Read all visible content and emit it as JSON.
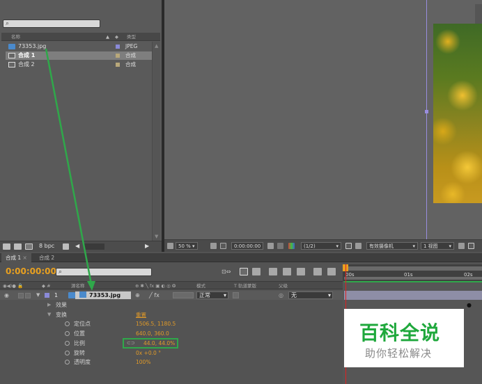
{
  "project": {
    "col_name": "名称",
    "col_type": "类型",
    "items": [
      {
        "name": "73353.jpg",
        "type": "JPEG",
        "swatch": "#8a8ad8",
        "icon": "image-file-icon"
      },
      {
        "name": "合成 1",
        "type": "合成",
        "swatch": "#b8a87a",
        "icon": "composition-icon",
        "selected": true
      },
      {
        "name": "合成 2",
        "type": "合成",
        "swatch": "#b8a87a",
        "icon": "composition-icon"
      }
    ],
    "footer_bpc": "8 bpc"
  },
  "viewer": {
    "zoom": "50 %",
    "timecode": "0:00:00:00",
    "resolution": "(1/2)",
    "camera": "有效摄像机",
    "views": "1 视图"
  },
  "timeline": {
    "tabs": [
      "合成 1",
      "合成 2"
    ],
    "timecode": "0:00:00:00",
    "ruler": [
      "00s",
      "01s",
      "02s"
    ],
    "columns": {
      "layer_name": "源名称",
      "mode": "模式",
      "trkmat": "T  轨道蒙版",
      "parent": "父级"
    },
    "layer": {
      "index": "1",
      "name": "73353.jpg",
      "mode": "正常",
      "parent": "无"
    },
    "groups": {
      "effects": "效果",
      "transform": "变换",
      "reset": "重置"
    },
    "properties": [
      {
        "name": "定位点",
        "value": "1506.5, 1180.5"
      },
      {
        "name": "位置",
        "value": "640.0, 360.0"
      },
      {
        "name": "比例",
        "value": "44.0, 44.0%"
      },
      {
        "name": "旋转",
        "value": "0x +0.0 °"
      },
      {
        "name": "透明度",
        "value": "100%"
      }
    ]
  },
  "watermark": {
    "title": "百科全说",
    "subtitle": "助你轻松解决"
  },
  "colors": {
    "timecode": "#e8a020",
    "property_value": "#e09a28",
    "annotation": "#2fa84a",
    "layer_bar": "#8e8ea6",
    "comp_border": "#9a8ee0"
  }
}
